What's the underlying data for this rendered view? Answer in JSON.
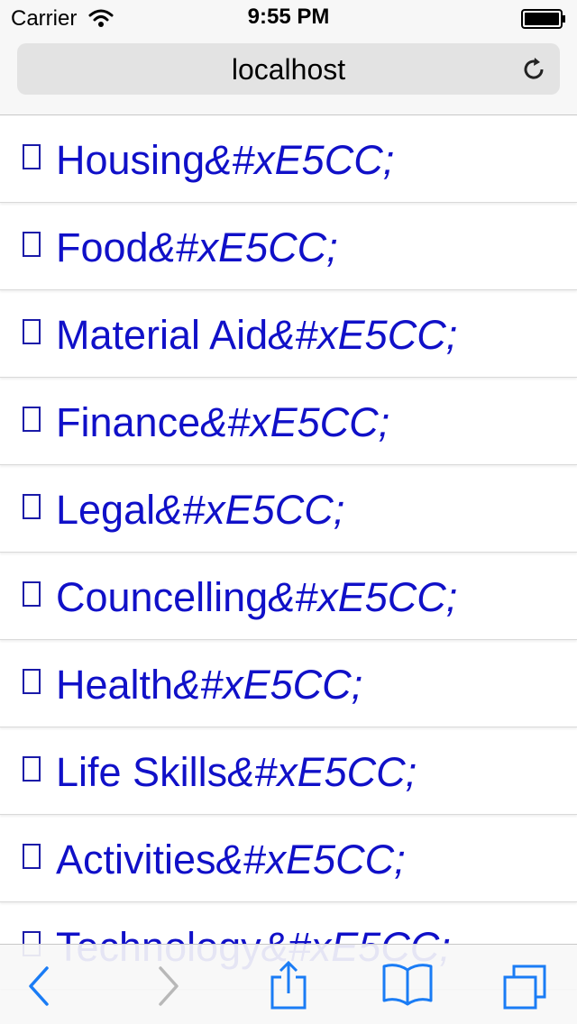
{
  "status": {
    "carrier": "Carrier",
    "time": "9:55 PM"
  },
  "address": {
    "host": "localhost"
  },
  "list": {
    "items": [
      {
        "label": "Housing",
        "suffix": "&#xE5CC;"
      },
      {
        "label": "Food",
        "suffix": "&#xE5CC;"
      },
      {
        "label": "Material Aid",
        "suffix": "&#xE5CC;"
      },
      {
        "label": "Finance",
        "suffix": "&#xE5CC;"
      },
      {
        "label": "Legal",
        "suffix": "&#xE5CC;"
      },
      {
        "label": "Councelling",
        "suffix": "&#xE5CC;"
      },
      {
        "label": "Health",
        "suffix": "&#xE5CC;"
      },
      {
        "label": "Life Skills",
        "suffix": "&#xE5CC;"
      },
      {
        "label": "Activities",
        "suffix": "&#xE5CC;"
      },
      {
        "label": "Technology",
        "suffix": "&#xE5CC;"
      }
    ]
  },
  "toolbar": {
    "icons": [
      "back-icon",
      "forward-icon",
      "share-icon",
      "bookmarks-icon",
      "tabs-icon"
    ],
    "accent": "#1a7cf5",
    "disabled": "#b8b8b8"
  },
  "colors": {
    "link": "#1010c8"
  }
}
